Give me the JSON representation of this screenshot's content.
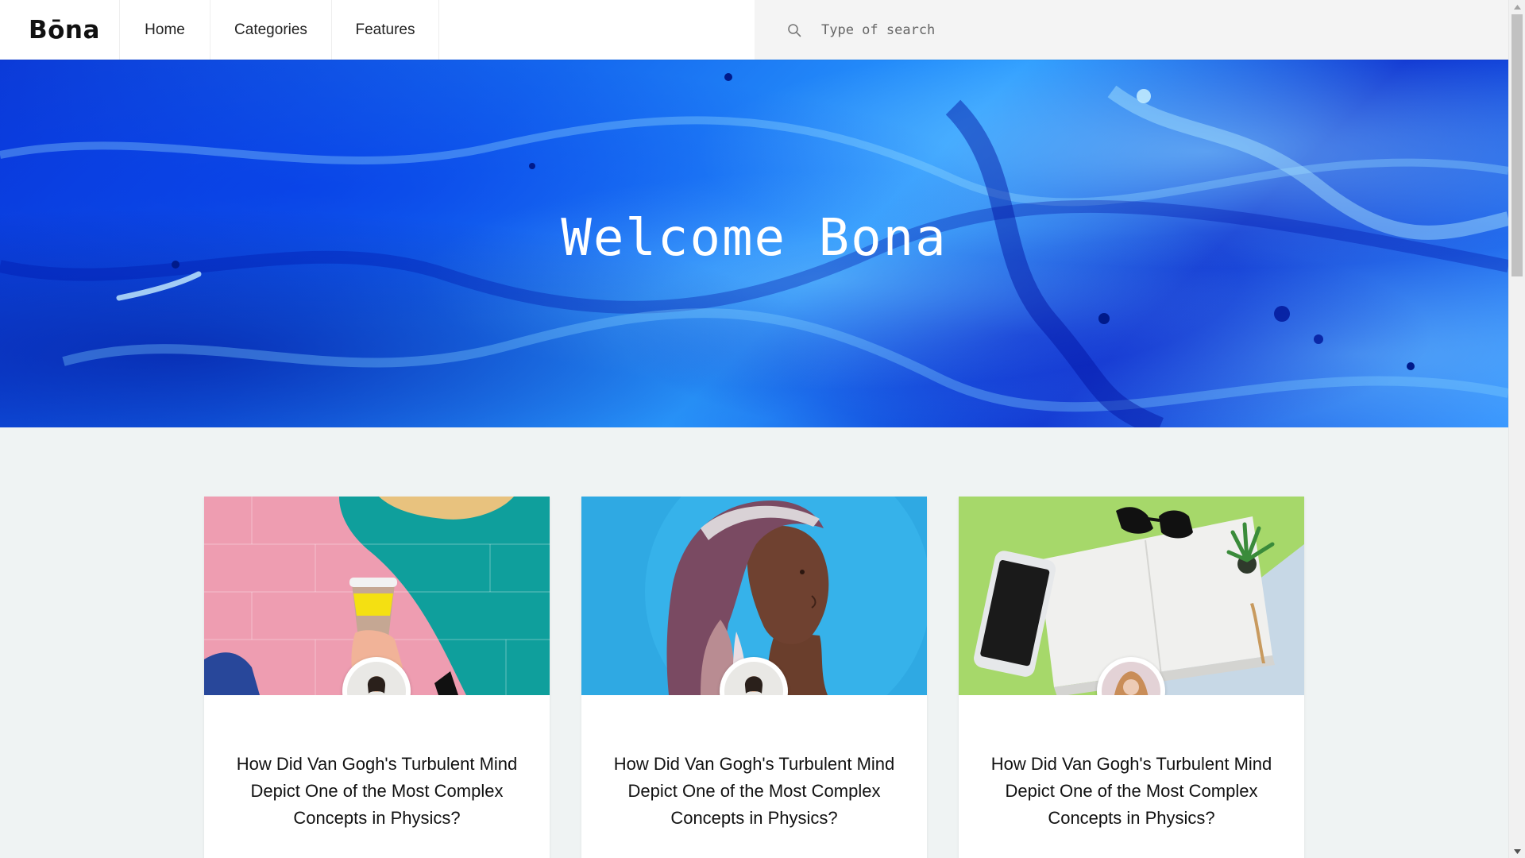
{
  "header": {
    "logo": "Bōna",
    "nav": [
      {
        "label": "Home"
      },
      {
        "label": "Categories"
      },
      {
        "label": "Features"
      }
    ],
    "search": {
      "placeholder": "Type of search",
      "icon": "search-icon"
    }
  },
  "hero": {
    "title": "Welcome Bona"
  },
  "posts": [
    {
      "title": "How Did Van Gogh's Turbulent Mind Depict One of the Most Complex Concepts in Physics?",
      "image": "coffee-cup-wall",
      "author_avatar": "woman-holding-red-object"
    },
    {
      "title": "How Did Van Gogh's Turbulent Mind Depict One of the Most Complex Concepts in Physics?",
      "image": "woman-headscarf-portrait",
      "author_avatar": "woman-holding-red-object"
    },
    {
      "title": "How Did Van Gogh's Turbulent Mind Depict One of the Most Complex Concepts in Physics?",
      "image": "phone-notebook-sunglasses",
      "author_avatar": "woman-curly-hair"
    }
  ],
  "colors": {
    "page_bg": "#eff3f3",
    "hero_blue": "#1466ee",
    "card_bg": "#ffffff"
  }
}
